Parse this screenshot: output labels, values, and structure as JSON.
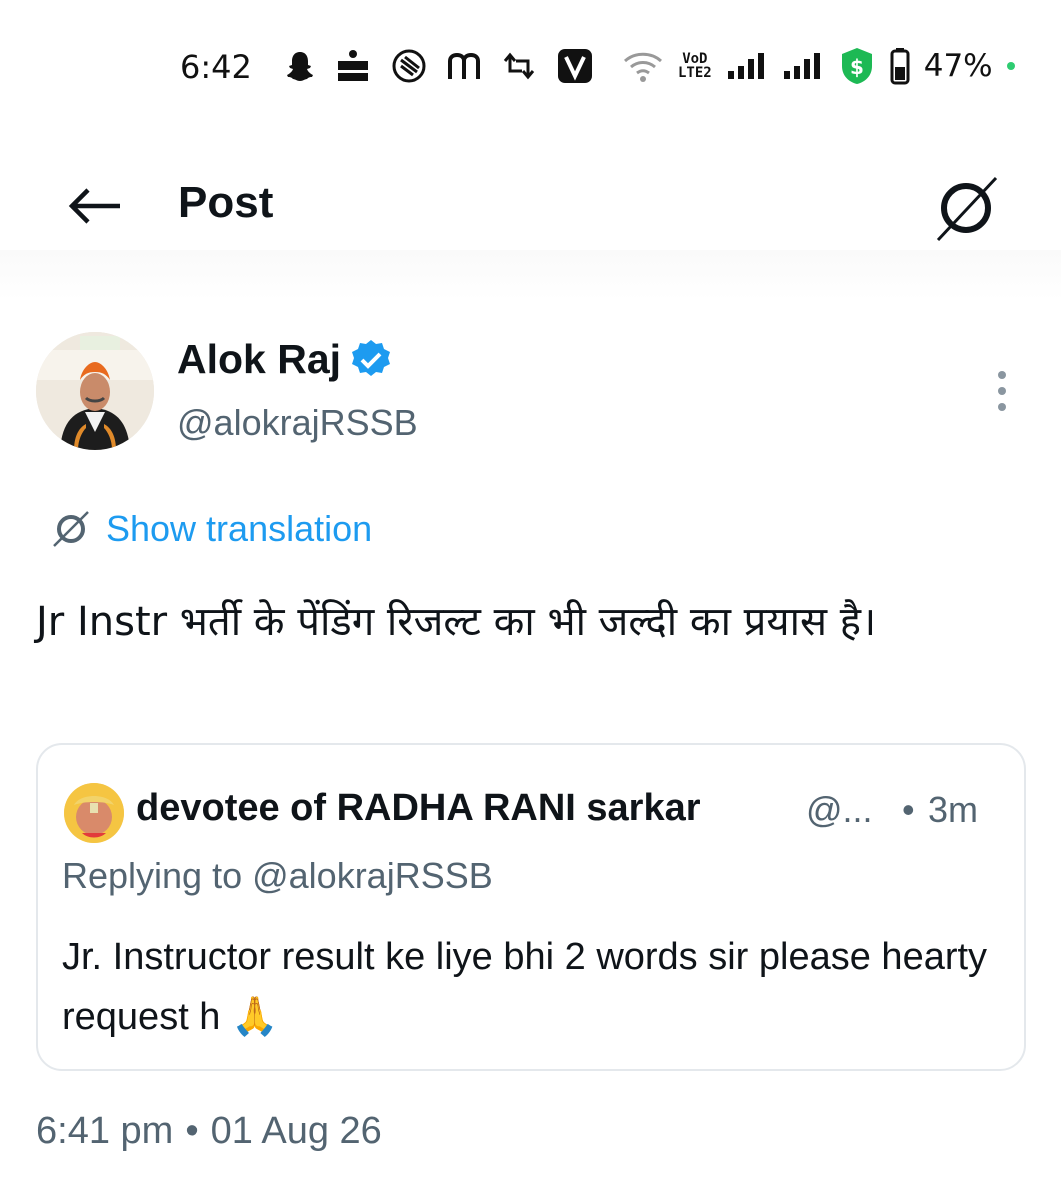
{
  "status_bar": {
    "time": "6:42",
    "battery": "47%",
    "network_badge": "VoLTE2",
    "icons": [
      "snapchat-icon",
      "dainik-bhaskar-icon",
      "app-icon",
      "m-app-icon",
      "retweet-icon",
      "v-app-icon",
      "wifi-icon",
      "signal-icon",
      "signal-icon",
      "shield-dollar-icon",
      "battery-icon"
    ]
  },
  "header": {
    "title": "Post",
    "back_icon": "arrow-left-icon",
    "translate_icon": "translate-icon"
  },
  "author": {
    "name": "Alok Raj",
    "handle": "@alokrajRSSB",
    "verified": true,
    "verified_color": "#1d9bf0"
  },
  "translation": {
    "label": "Show translation"
  },
  "tweet": {
    "text": "Jr Instr भर्ती के पेंडिंग रिजल्ट का भी जल्दी का प्रयास है।"
  },
  "quote": {
    "author_name": "devotee of RADHA RANI sarkar",
    "author_handle": "@...",
    "separator": "•",
    "time": "3m",
    "replying_prefix": "Replying to ",
    "replying_handle": "@alokrajRSSB",
    "text": "Jr. Instructor result ke liye bhi 2 words sir please hearty request h 🙏"
  },
  "footer": {
    "time": "6:41 pm",
    "separator": "•",
    "date": "01 Aug 26"
  },
  "colors": {
    "accent": "#1d9bf0",
    "secondary_text": "#536471",
    "primary_text": "#0f1419",
    "border": "#e4e8ec"
  }
}
